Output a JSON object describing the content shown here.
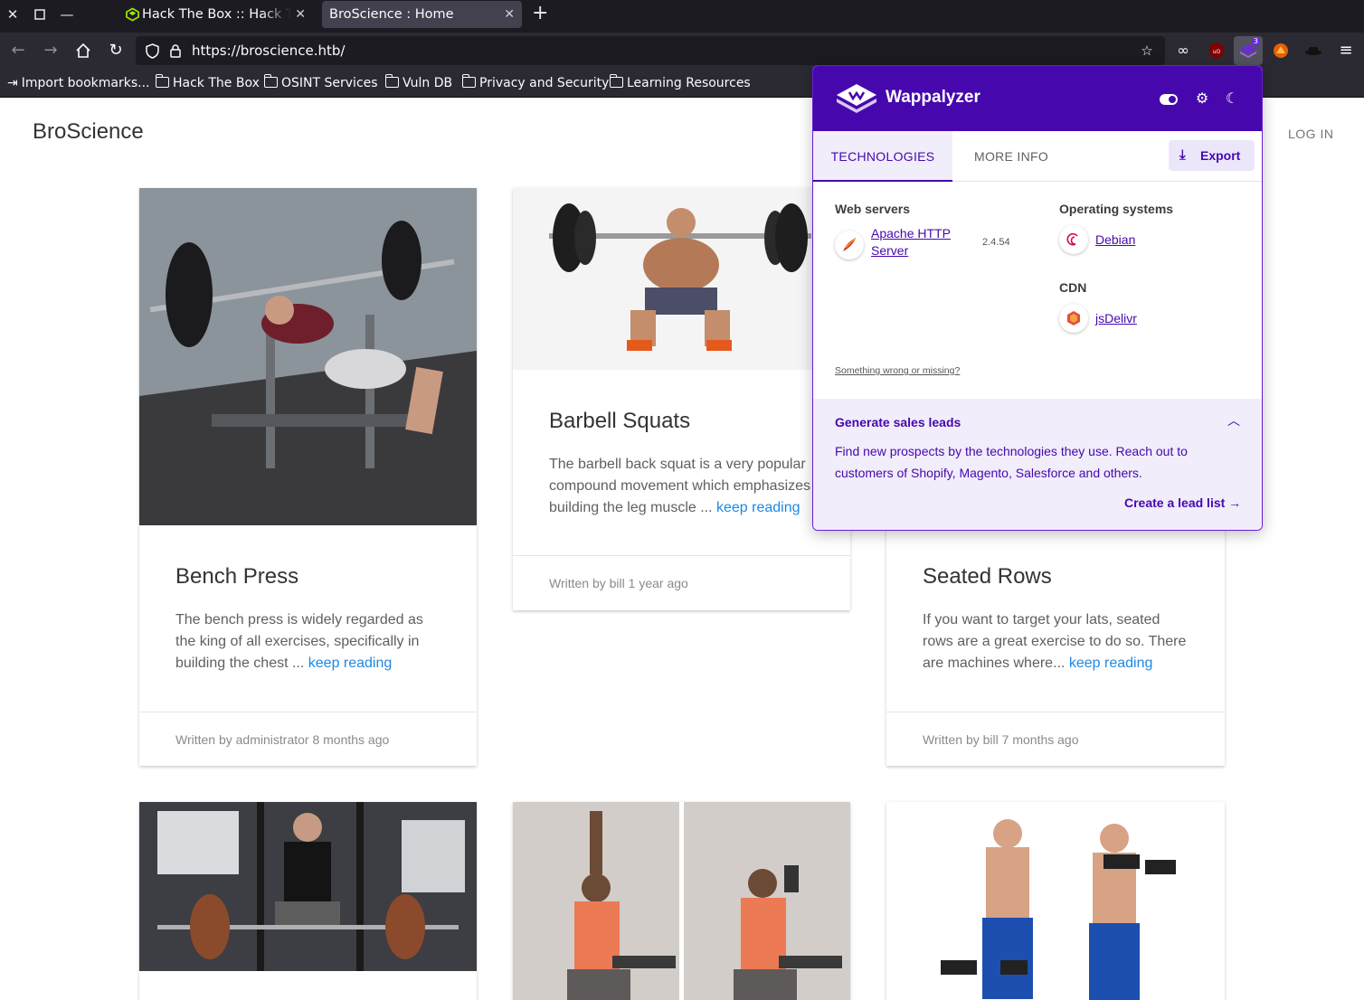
{
  "browser": {
    "tabs": [
      {
        "title": "Hack The Box :: Hack The Box",
        "active": false
      },
      {
        "title": "BroScience : Home",
        "active": true
      }
    ],
    "close_glyph": "✕",
    "new_tab_glyph": "+",
    "url": "https://broscience.htb/",
    "bookmarks": [
      {
        "label": "Import bookmarks...",
        "icon": "import-icon"
      },
      {
        "label": "Hack The Box",
        "icon": "folder-icon"
      },
      {
        "label": "OSINT Services",
        "icon": "folder-icon"
      },
      {
        "label": "Vuln DB",
        "icon": "folder-icon"
      },
      {
        "label": "Privacy and Security",
        "icon": "folder-icon"
      },
      {
        "label": "Learning Resources",
        "icon": "folder-icon"
      }
    ],
    "extension_badge": "3",
    "accent": "#42414d"
  },
  "site": {
    "brand": "BroScience",
    "login": "LOG IN",
    "more_label": "keep reading",
    "posts": [
      {
        "title": "Bench Press",
        "excerpt": "The bench press is widely regarded as the king of all exercises, specifically in building the chest ...",
        "footer": "Written by administrator 8 months ago"
      },
      {
        "title": "Barbell Squats",
        "excerpt": "The barbell back squat is a very popular compound movement which emphasizes building the leg muscle ...",
        "footer": "Written by bill 1 year ago"
      },
      {
        "title": "Seated Rows",
        "excerpt": "If you want to target your lats, seated rows are a great exercise to do so. There are machines where...",
        "footer": "Written by bill 7 months ago"
      }
    ],
    "link_color": "#1e88e5"
  },
  "wappalyzer": {
    "name": "Wappalyzer",
    "tabs": {
      "technologies": "TECHNOLOGIES",
      "more_info": "MORE INFO"
    },
    "export": "Export",
    "categories": {
      "web_servers": {
        "title": "Web servers",
        "tech_name_line1": "Apache HTTP",
        "tech_name_line2": "Server",
        "version": "2.4.54"
      },
      "operating_systems": {
        "title": "Operating systems",
        "tech_name": "Debian"
      },
      "cdn": {
        "title": "CDN",
        "tech_name": "jsDelivr"
      }
    },
    "feedback": "Something wrong or missing?",
    "leads": {
      "title": "Generate sales leads",
      "text": "Find new prospects by the technologies they use. Reach out to customers of Shopify, Magento, Salesforce and others.",
      "cta": "Create a lead list"
    },
    "brand_color": "#4608ad"
  }
}
